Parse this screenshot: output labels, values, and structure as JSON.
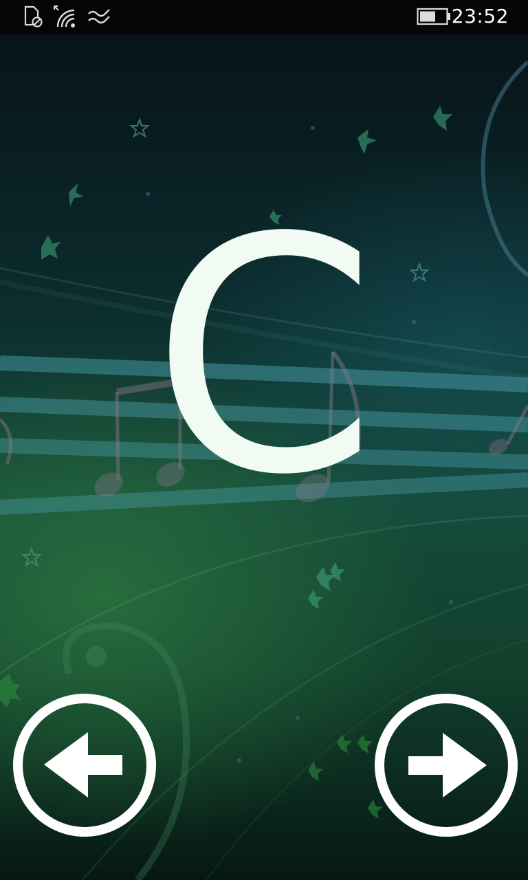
{
  "status_bar": {
    "time": "23:52",
    "icons": [
      "sim-blocked-icon",
      "wifi-icon",
      "data-sense-icon",
      "battery-icon"
    ],
    "battery_level": 0.6
  },
  "main": {
    "note": "C"
  },
  "navigation": {
    "prev_icon": "arrow-left-icon",
    "next_icon": "arrow-right-icon"
  },
  "colors": {
    "letter": "#f1fbf3",
    "button_stroke": "#ffffff",
    "status_bar_bg": "#050505"
  }
}
